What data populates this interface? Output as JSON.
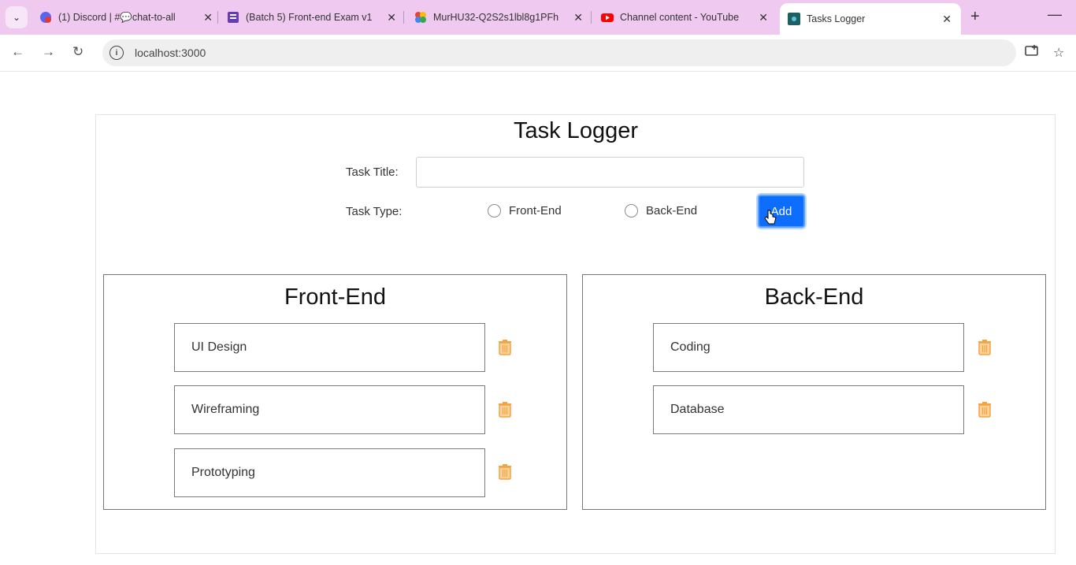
{
  "browser": {
    "tabs": [
      {
        "title": "(1) Discord | #💬chat-to-all",
        "icon": "discord-icon",
        "active": false
      },
      {
        "title": "(Batch 5) Front-end Exam v1",
        "icon": "form-icon",
        "active": false
      },
      {
        "title": "MurHU32-Q2S2s1lbl8g1PFh",
        "icon": "photos-icon",
        "active": false
      },
      {
        "title": "Channel content - YouTube",
        "icon": "youtube-icon",
        "active": false
      },
      {
        "title": "Tasks Logger",
        "icon": "react-icon",
        "active": true
      }
    ],
    "url": "localhost:3000"
  },
  "app": {
    "title": "Task Logger",
    "form": {
      "task_title_label": "Task Title:",
      "task_title_value": "",
      "task_type_label": "Task Type:",
      "options": [
        "Front-End",
        "Back-End"
      ],
      "add_label": "Add"
    },
    "columns": [
      {
        "title": "Front-End",
        "tasks": [
          "UI Design",
          "Wireframing",
          "Prototyping"
        ]
      },
      {
        "title": "Back-End",
        "tasks": [
          "Coding",
          "Database"
        ]
      }
    ]
  },
  "colors": {
    "tab_strip": "#efc9ef",
    "add_button": "#0d6efd",
    "trash_icon": "#f4a340"
  }
}
